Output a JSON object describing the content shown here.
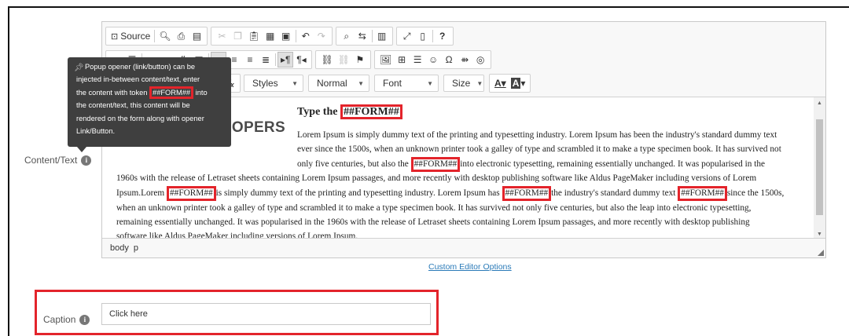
{
  "labels": {
    "content_text": "Content/Text",
    "caption": "Caption"
  },
  "toolbar": {
    "row1": {
      "source": "Source",
      "icons": [
        "preview-icon",
        "print-icon",
        "templates-icon",
        "cut-icon",
        "copy-icon",
        "paste-icon",
        "paste-text-icon",
        "paste-word-icon",
        "undo-icon",
        "redo-icon",
        "find-icon",
        "replace-icon",
        "select-all-icon",
        "maximize-icon",
        "show-blocks-icon",
        "help-icon"
      ],
      "help": "?"
    },
    "row3": {
      "styles": "Styles",
      "format": "Normal",
      "font": "Font",
      "size": "Size"
    }
  },
  "content": {
    "heading_prefix": "Type the ",
    "token": "##FORM##",
    "brand": "DNNDEVELOPERS",
    "p1_line1": "Lorem Ipsum is simply dummy text of the printing and typesetting industry. Lorem Ipsum has been the industry's standard dummy text",
    "p1_line2": "ever since the 1500s, when an unknown printer took a galley of type and scrambled it to make a type specimen book. It has survived not",
    "p1_line3_a": "only five centuries, but also the ",
    "p1_line3_b": "into electronic typesetting, remaining essentially unchanged. It was popularised in the",
    "p1_line4": "1960s with the release of Letraset sheets containing Lorem Ipsum passages, and more recently with desktop publishing software like Aldus PageMaker including versions of Lorem",
    "p1_line5_a": "Ipsum.Lorem ",
    "p1_line5_b": "is simply dummy text of the printing and typesetting industry. Lorem Ipsum has ",
    "p1_line5_c": "the industry's standard dummy text ",
    "p1_line5_d": "since the 1500s,",
    "p1_line6": "when an unknown printer took a galley of type and scrambled it to make a type specimen book. It has survived not only five centuries, but also the leap into electronic typesetting,",
    "p1_line7": "remaining essentially unchanged. It was popularised in the 1960s with the release of Letraset sheets containing Lorem Ipsum passages, and more recently with desktop publishing",
    "p1_line8": "software like Aldus PageMaker including versions of Lorem Ipsum."
  },
  "statusbar": {
    "path1": "body",
    "path2": "p"
  },
  "tooltip": {
    "line1": "Popup opener (link/button) can be",
    "line2": "injected in-between content/text, enter",
    "line3_a": "the content with token ",
    "line3_b": " into",
    "line4": "the content/text, this content will be",
    "line5": "rendered on the form along with opener",
    "line6": "Link/Button."
  },
  "custom_editor_link": "Custom Editor Options",
  "caption": {
    "value": "Click here"
  },
  "colors": {
    "highlight": "#e3242b",
    "link": "#2a7ab8",
    "tooltip_bg": "#3f3f3f"
  }
}
